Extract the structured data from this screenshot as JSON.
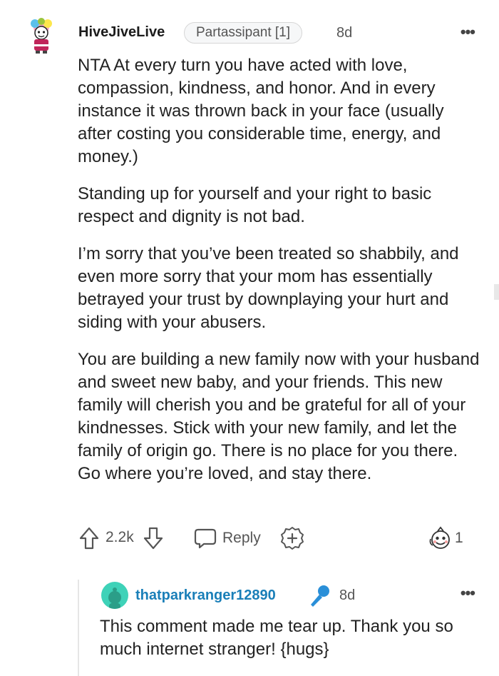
{
  "comment": {
    "author": "HiveJiveLive",
    "flair": "Partassipant [1]",
    "time": "8d",
    "more": "•••",
    "paragraphs": [
      "NTA At every turn you have acted with love, compassion, kindness, and honor. And in every instance it was thrown back in your face (usually after costing you considerable time, energy, and money.)",
      "Standing up for yourself and your right to basic respect and dignity is not bad.",
      "I’m sorry that you’ve been treated so shabbily, and even more sorry that your mom has essentially betrayed your trust by downplaying your hurt and siding with your abusers.",
      "You are building a new family now with your husband and sweet new baby, and your friends. This new family will cherish you and be grateful for all of your kindnesses. Stick with your new family, and let the family of origin go. There is no place for you there. Go where you’re loved, and stay there."
    ],
    "votes": "2.2k",
    "reply_label": "Reply",
    "award_count": "1"
  },
  "reply": {
    "author": "thatparkranger12890",
    "time": "8d",
    "more": "•••",
    "text": "This comment made me tear up. Thank you so much internet stranger! {hugs}"
  },
  "colors": {
    "reply_author": "#1a7fb8",
    "reply_avatar": "#3ed2b8",
    "mic_icon": "#2a8fd8"
  }
}
